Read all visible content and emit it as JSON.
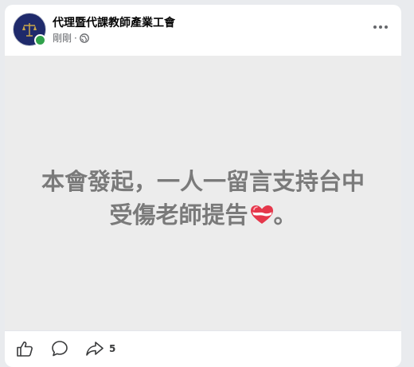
{
  "post": {
    "page_name": "代理暨代課教師產業工會",
    "timestamp": "剛剛",
    "separator": "·",
    "text_line1": "本會發起，一人一留言支持台中",
    "text_line2": "受傷老師提告",
    "text_end": "。"
  },
  "actions": {
    "share_count": "5"
  },
  "icons": {
    "privacy": "globe-icon",
    "more": "more-horizontal-icon",
    "like": "thumbs-up-icon",
    "comment": "comment-icon",
    "share": "share-arrow-icon",
    "heart": "heart-ribbon-icon"
  },
  "colors": {
    "online": "#31a24c",
    "post_background": "#ececec",
    "post_text": "#7a7a7a"
  }
}
